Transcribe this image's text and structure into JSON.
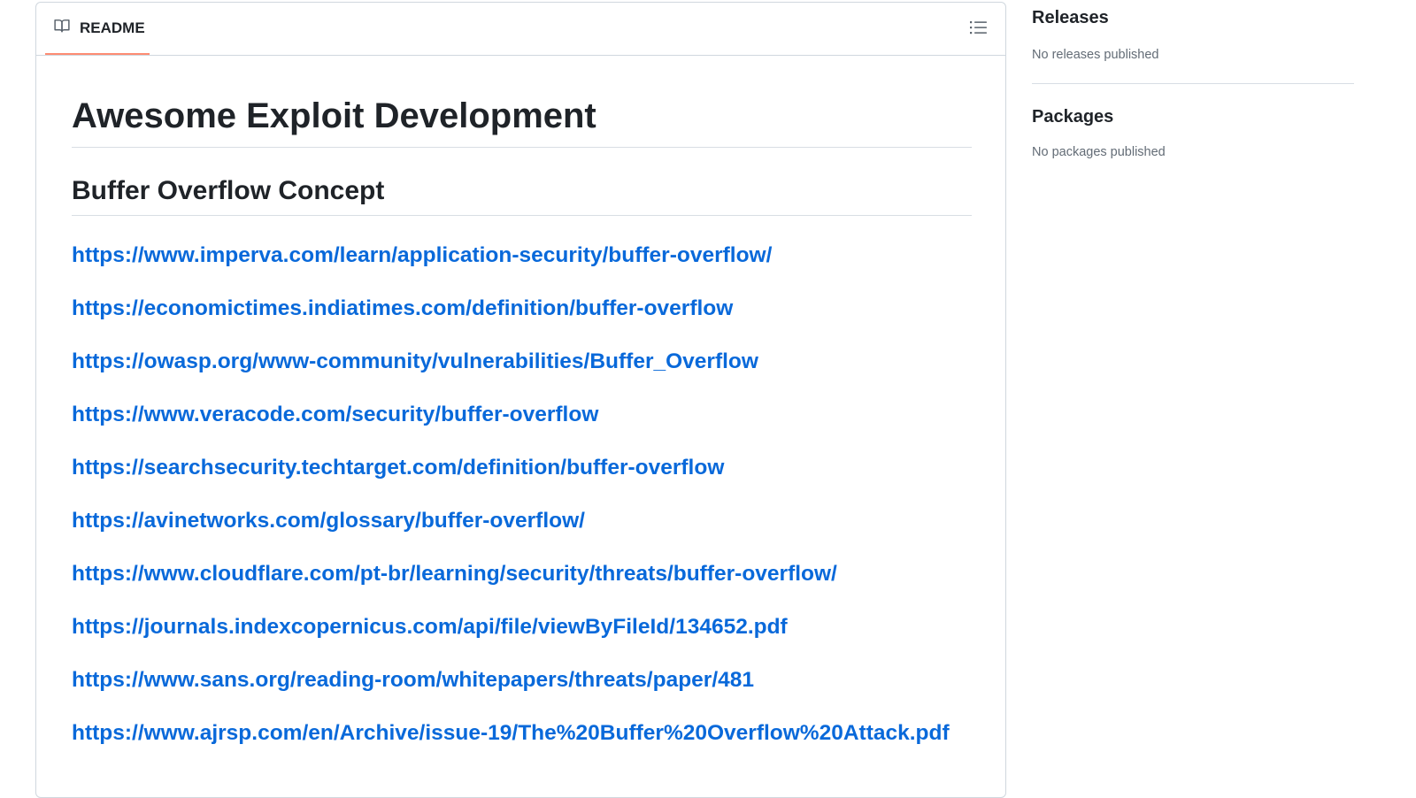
{
  "readme": {
    "tab_label": "README",
    "title": "Awesome Exploit Development",
    "section_heading": "Buffer Overflow Concept",
    "links": [
      "https://www.imperva.com/learn/application-security/buffer-overflow/",
      "https://economictimes.indiatimes.com/definition/buffer-overflow",
      "https://owasp.org/www-community/vulnerabilities/Buffer_Overflow",
      "https://www.veracode.com/security/buffer-overflow",
      "https://searchsecurity.techtarget.com/definition/buffer-overflow",
      "https://avinetworks.com/glossary/buffer-overflow/",
      "https://www.cloudflare.com/pt-br/learning/security/threats/buffer-overflow/",
      "https://journals.indexcopernicus.com/api/file/viewByFileId/134652.pdf",
      "https://www.sans.org/reading-room/whitepapers/threats/paper/481",
      "https://www.ajrsp.com/en/Archive/issue-19/The%20Buffer%20Overflow%20Attack.pdf"
    ]
  },
  "sidebar": {
    "releases": {
      "title": "Releases",
      "text": "No releases published"
    },
    "packages": {
      "title": "Packages",
      "text": "No packages published"
    }
  },
  "icons": {
    "tab": "book-icon",
    "outline": "list-unordered-icon"
  },
  "colors": {
    "link": "#0969da",
    "tab_underline": "#fd8c73",
    "muted_text": "#636c76",
    "border": "#d0d7de"
  }
}
